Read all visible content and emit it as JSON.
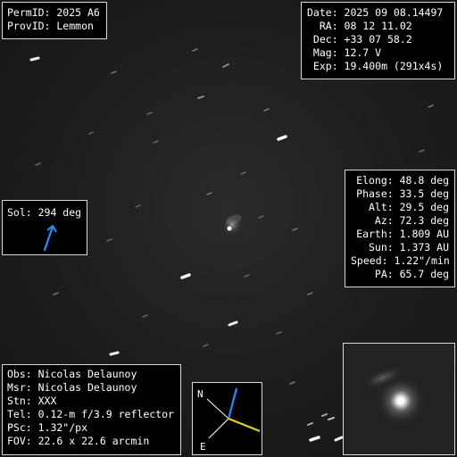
{
  "ident": {
    "perm_id": "PermID: 2025 A6",
    "prov_id": "ProvID: Lemmon"
  },
  "observation": {
    "date": "Date: 2025 09 08.14497",
    "ra": "  RA: 08 12 11.02",
    "dec": " Dec: +33 07 58.2",
    "mag": " Mag: 12.7 V",
    "exp": " Exp: 19.400m (291x4s)"
  },
  "sol": {
    "label": "Sol: 294 deg",
    "arrow_color": "#1e90ff",
    "angle_deg": 294
  },
  "geometry": {
    "elong": "Elong: 48.8 deg",
    "phase": "Phase: 33.5 deg",
    "alt": "Alt: 29.5 deg",
    "az": "Az: 72.3 deg",
    "earth": "Earth: 1.809 AU",
    "sun": "Sun: 1.373 AU",
    "speed": "Speed: 1.22\"/min",
    "pa": "PA: 65.7 deg"
  },
  "observer": {
    "obs": "Obs: Nicolas Delaunoy",
    "msr": "Msr: Nicolas Delaunoy",
    "stn": "Stn: XXX",
    "tel": "Tel: 0.12-m f/3.9 reflector",
    "psc": "PSc: 1.32\"/px",
    "fov": "FOV: 22.6 x 22.6 arcmin"
  },
  "compass": {
    "north_label": "N",
    "east_label": "E",
    "motion_color": "#1e90ff",
    "pa_color": "#e8d020"
  }
}
